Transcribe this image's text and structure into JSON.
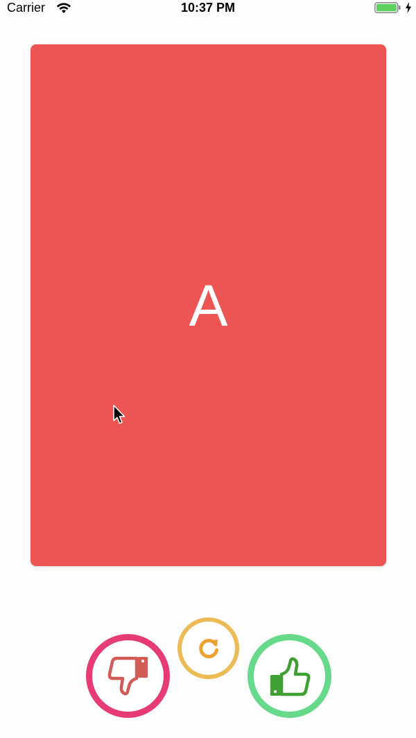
{
  "status_bar": {
    "carrier": "Carrier",
    "time": "10:37 PM",
    "battery_level": 1.0
  },
  "card": {
    "letter": "A",
    "background_color": "#ec5553"
  },
  "actions": {
    "dislike": {
      "icon": "thumbs-down-icon",
      "ring_color": "#e63b74",
      "icon_color": "#d25a57"
    },
    "undo": {
      "icon": "undo-icon",
      "ring_color": "#edbb55",
      "icon_color": "#eda22f"
    },
    "like": {
      "icon": "thumbs-up-icon",
      "ring_color": "#67d98b",
      "icon_color": "#3ea033"
    }
  },
  "colors": {
    "background": "#fefdfe"
  }
}
